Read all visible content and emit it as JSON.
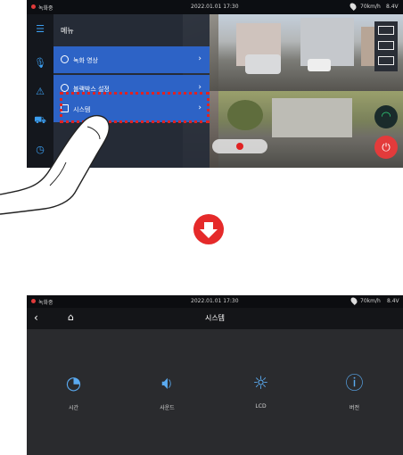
{
  "colors": {
    "accent_blue": "#2d63c6",
    "icon_blue": "#3b9ef0",
    "highlight_red": "#e02222",
    "arrow_red": "#e52a2a",
    "wifi_green": "#2fd17a"
  },
  "before_screen": {
    "status_bar": {
      "rec_label": "녹화중",
      "datetime": "2022.01.01 17:30",
      "speed": "70km/h",
      "voltage": "8.4V"
    },
    "menu": {
      "title": "메뉴",
      "items": [
        {
          "label": "녹화 영상",
          "icon": "play-circle-icon"
        },
        {
          "label": "블랙박스 설정",
          "icon": "settings-icon"
        },
        {
          "label": "시스템",
          "icon": "system-icon",
          "highlighted": true
        }
      ]
    },
    "sidebar_icons": [
      "menu-icon",
      "microphone-icon",
      "warning-icon",
      "car-icon",
      "clock-icon"
    ]
  },
  "transition_icon": "down-arrow-icon",
  "after_screen": {
    "status_bar": {
      "rec_label": "녹화중",
      "datetime": "2022.01.01 17:30",
      "speed": "70km/h",
      "voltage": "8.4V"
    },
    "header": {
      "back_icon": "back-icon",
      "home_icon": "home-icon",
      "title": "시스템"
    },
    "tiles": [
      {
        "label": "시간",
        "icon": "clock-icon"
      },
      {
        "label": "사운드",
        "icon": "speaker-icon"
      },
      {
        "label": "LCD",
        "icon": "brightness-icon"
      },
      {
        "label": "버전",
        "icon": "info-icon"
      }
    ]
  }
}
